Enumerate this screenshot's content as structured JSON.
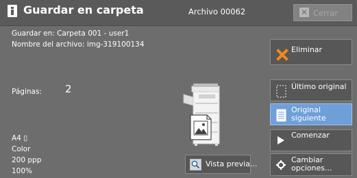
{
  "header": {
    "title": "Guardar en carpeta",
    "archive": "Archivo 00062",
    "close_label": "Cerrar"
  },
  "info": {
    "save_in": "Guardar en: Carpeta 001 - user1",
    "filename": "Nombre del archivo: img-319100134",
    "pages_label": "Páginas:",
    "pages_value": "2",
    "paper": "A4 ▯",
    "color": "Color",
    "resolution": "200 ppp",
    "scale": "100%"
  },
  "buttons": {
    "delete": "Eliminar",
    "last_original": "Último original",
    "next_original": "Original siguiente",
    "start": "Comenzar",
    "change_options": "Cambiar opciones...",
    "preview": "Vista previa..."
  },
  "colors": {
    "background": "#6d6d6d",
    "header": "#5a5a5a",
    "button": "#575757",
    "active": "#6f9fd8",
    "delete_icon": "#f08a1e"
  },
  "icons": {
    "title": "info-icon",
    "close": "close-icon",
    "delete": "x-icon",
    "last_original": "dotted-page-icon",
    "next_original": "document-icon",
    "start": "play-icon",
    "change_options": "gear-icon",
    "preview": "magnifier-icon"
  }
}
